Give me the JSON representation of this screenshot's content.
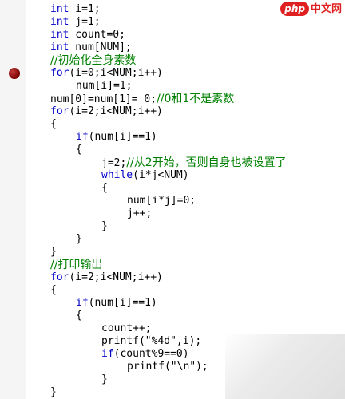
{
  "watermark": {
    "logo": "php",
    "text": "中文网"
  },
  "code": {
    "l01": {
      "kw": "int",
      "rest": " i=1;"
    },
    "l02": {
      "kw": "int",
      "rest": " j=1;"
    },
    "l03": {
      "kw": "int",
      "rest": " count=0;"
    },
    "l04": {
      "kw": "int",
      "rest": " num[NUM];"
    },
    "l05": {
      "comment": "//初始化全身素数"
    },
    "l06": {
      "kw": "for",
      "rest": "(i=0;i<NUM;i++)"
    },
    "l07": {
      "text": "num[i]=1;"
    },
    "l08": {
      "text": "num[0]=num[1]= 0;",
      "comment": "//0和1不是素数"
    },
    "l09": {
      "kw": "for",
      "rest": "(i=2;i<NUM;i++)"
    },
    "l10": {
      "text": "{"
    },
    "l11": {
      "kw": "if",
      "rest": "(num[i]==1)"
    },
    "l12": {
      "text": "{"
    },
    "l13": {
      "text": "j=2;",
      "comment": "//从2开始，否则自身也被设置了"
    },
    "l14": {
      "kw": "while",
      "rest": "(i*j<NUM)"
    },
    "l15": {
      "text": "{"
    },
    "l16": {
      "text": "num[i*j]=0;"
    },
    "l17": {
      "text": "j++;"
    },
    "l18": {
      "text": "}"
    },
    "l19": {
      "text": "}"
    },
    "l20": {
      "text": "}"
    },
    "l21": {
      "comment": "//打印输出"
    },
    "l22": {
      "kw": "for",
      "rest": "(i=2;i<NUM;i++)"
    },
    "l23": {
      "text": "{"
    },
    "l24": {
      "kw": "if",
      "rest": "(num[i]==1)"
    },
    "l25": {
      "text": "{"
    },
    "l26": {
      "text": "count++;"
    },
    "l27": {
      "text": "printf(\"%4d\",i);"
    },
    "l28": {
      "kw": "if",
      "rest": "(count%9==0)"
    },
    "l29": {
      "text": "printf(\"\\n\");"
    },
    "l30": {
      "text": "}"
    },
    "l31": {
      "text": "}"
    }
  }
}
